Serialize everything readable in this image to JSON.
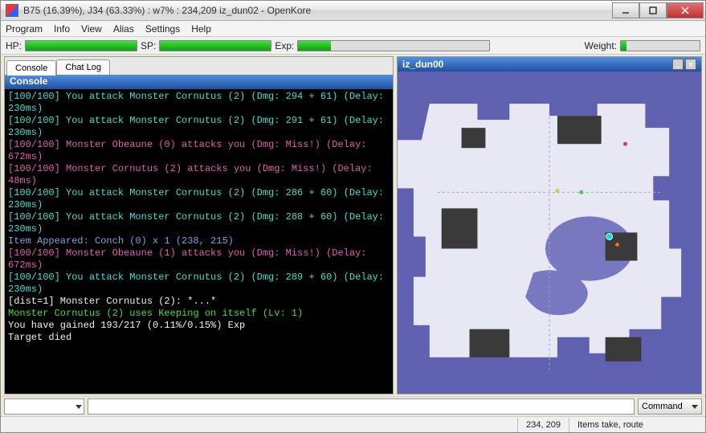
{
  "window": {
    "title": "B75 (16.39%), J34 (63.33%) : w7% : 234,209 iz_dun02 - OpenKore"
  },
  "menu": {
    "program": "Program",
    "info": "Info",
    "view": "View",
    "alias": "Alias",
    "settings": "Settings",
    "help": "Help"
  },
  "stats": {
    "hp_label": "HP:",
    "sp_label": "SP:",
    "exp_label": "Exp:",
    "weight_label": "Weight:",
    "hp_pct": 100,
    "sp_pct": 100,
    "exp_pct": 17,
    "weight_pct": 7
  },
  "tabs": {
    "console": "Console",
    "chatlog": "Chat Log"
  },
  "console": {
    "header": "Console",
    "lines": [
      {
        "c": "cyan",
        "t": "[100/100] You attack Monster Cornutus (2) (Dmg: 294 + 61) (Delay: 230ms)"
      },
      {
        "c": "cyan",
        "t": "[100/100] You attack Monster Cornutus (2) (Dmg: 291 + 61) (Delay: 230ms)"
      },
      {
        "c": "magenta",
        "t": "[100/100] Monster Obeaune (0) attacks you (Dmg: Miss!) (Delay: 672ms)"
      },
      {
        "c": "magenta",
        "t": "[100/100] Monster Cornutus (2) attacks you (Dmg: Miss!) (Delay: 48ms)"
      },
      {
        "c": "cyan",
        "t": "[100/100] You attack Monster Cornutus (2) (Dmg: 286 + 60) (Delay: 230ms)"
      },
      {
        "c": "cyan",
        "t": "[100/100] You attack Monster Cornutus (2) (Dmg: 288 + 60) (Delay: 230ms)"
      },
      {
        "c": "lightblue",
        "t": "Item Appeared: Conch (0) x 1 (238, 215)"
      },
      {
        "c": "magenta",
        "t": "[100/100] Monster Obeaune (1) attacks you (Dmg: Miss!) (Delay: 672ms)"
      },
      {
        "c": "cyan",
        "t": "[100/100] You attack Monster Cornutus (2) (Dmg: 289 + 60) (Delay: 230ms)"
      },
      {
        "c": "white",
        "t": "[dist=1] Monster Cornutus (2): *...*"
      },
      {
        "c": "green",
        "t": "Monster Cornutus (2) uses Keeping on itself (Lv: 1)"
      },
      {
        "c": "white",
        "t": "You have gained 193/217 (0.11%/0.15%) Exp"
      },
      {
        "c": "white",
        "t": "Target died"
      }
    ]
  },
  "map": {
    "header": "iz_dun00"
  },
  "command": {
    "label": "Command",
    "input": ""
  },
  "status": {
    "coords": "234, 209",
    "info": "Items take, route"
  }
}
